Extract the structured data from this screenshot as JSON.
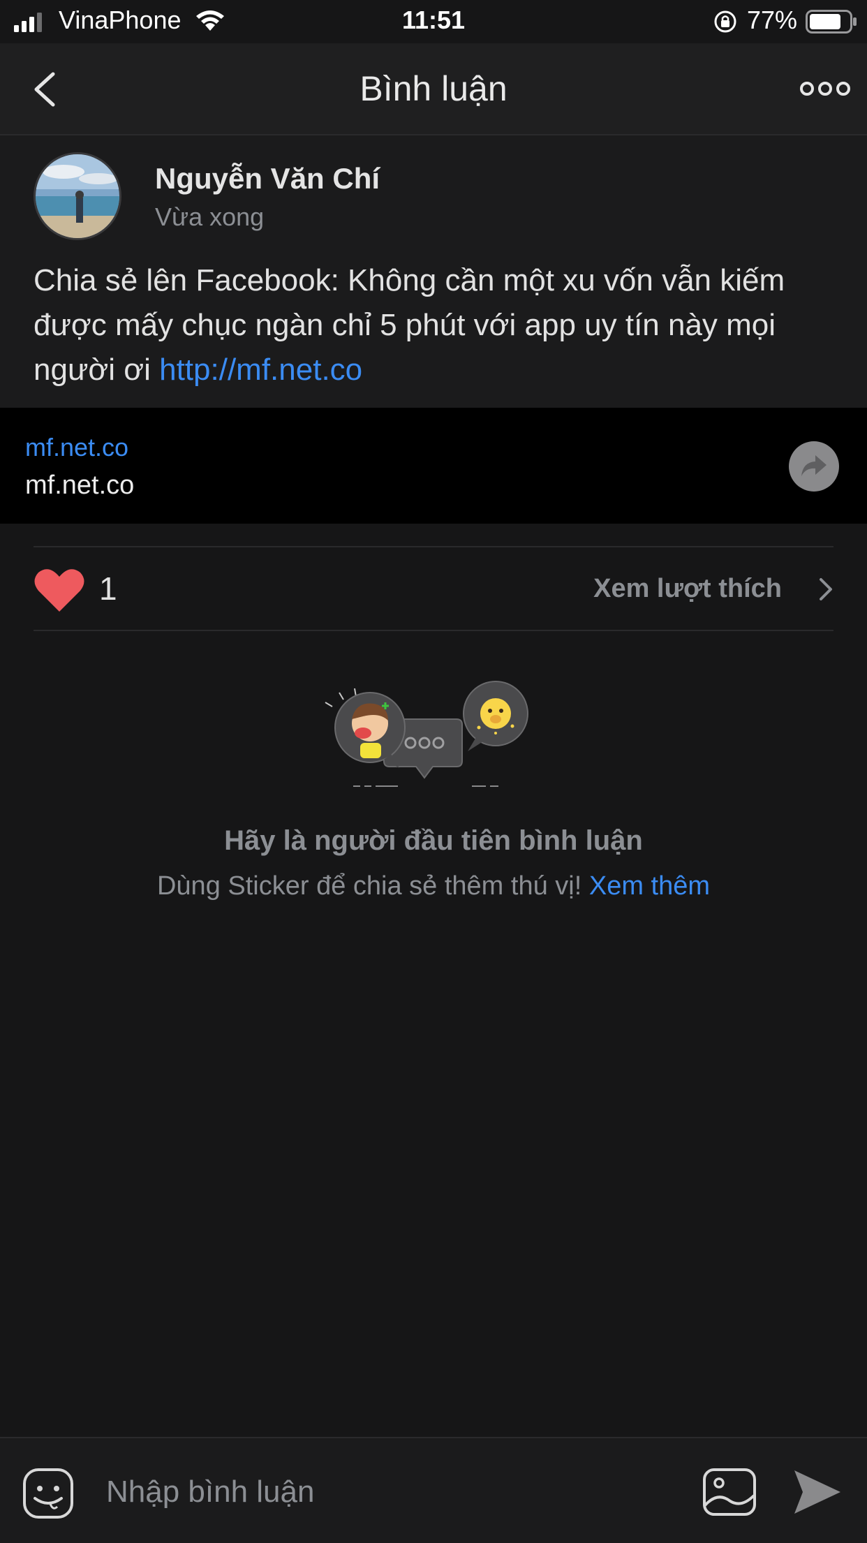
{
  "status_bar": {
    "carrier": "VinaPhone",
    "time": "11:51",
    "battery": "77%"
  },
  "nav": {
    "title": "Bình luận"
  },
  "post": {
    "author": "Nguyễn Văn Chí",
    "time": "Vừa xong",
    "text": "Chia sẻ lên Facebook: Không cần một xu vốn vẫn kiếm được mấy chục ngàn chỉ 5 phút với app uy tín này mọi người ơi ",
    "link": "http://mf.net.co"
  },
  "link_card": {
    "domain": "mf.net.co",
    "title": "mf.net.co"
  },
  "likes": {
    "count": "1",
    "view_label": "Xem lượt thích"
  },
  "empty_state": {
    "title": "Hãy là người đầu tiên bình luận",
    "subtitle": "Dùng Sticker để chia sẻ thêm thú vị! ",
    "see_more": "Xem thêm"
  },
  "composer": {
    "placeholder": "Nhập bình luận"
  },
  "colors": {
    "accent": "#3b8cf3",
    "heart": "#ee5a5e",
    "background": "#161617"
  }
}
